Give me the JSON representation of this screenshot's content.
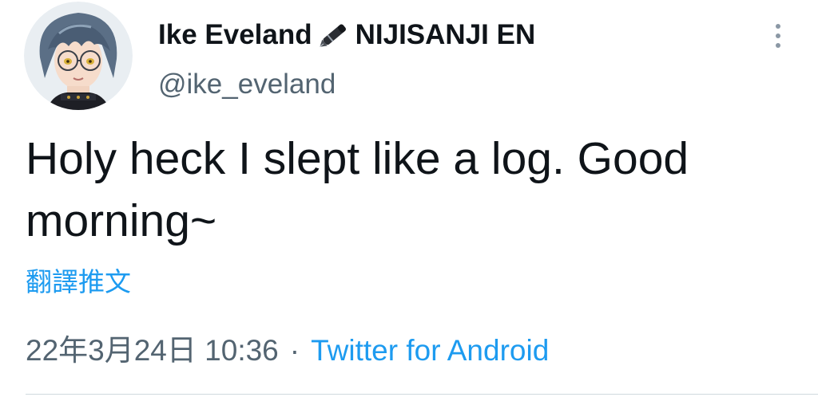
{
  "author": {
    "display_name_first": "Ike Eveland",
    "display_name_emoji_icon": "fountain-pen-icon",
    "display_name_second": "NIJISANJI EN",
    "handle": "@ike_eveland",
    "avatar_icon": "avatar"
  },
  "more_icon": "more-options-icon",
  "tweet": {
    "text": "Holy heck I slept like a log. Good morning~",
    "translate_label": "翻譯推文"
  },
  "meta": {
    "timestamp": "22年3月24日 10:36",
    "separator": "·",
    "source": "Twitter for Android"
  },
  "colors": {
    "text": "#0f1419",
    "secondary": "#536471",
    "link": "#1d9bf0",
    "divider": "#cfd9de"
  }
}
